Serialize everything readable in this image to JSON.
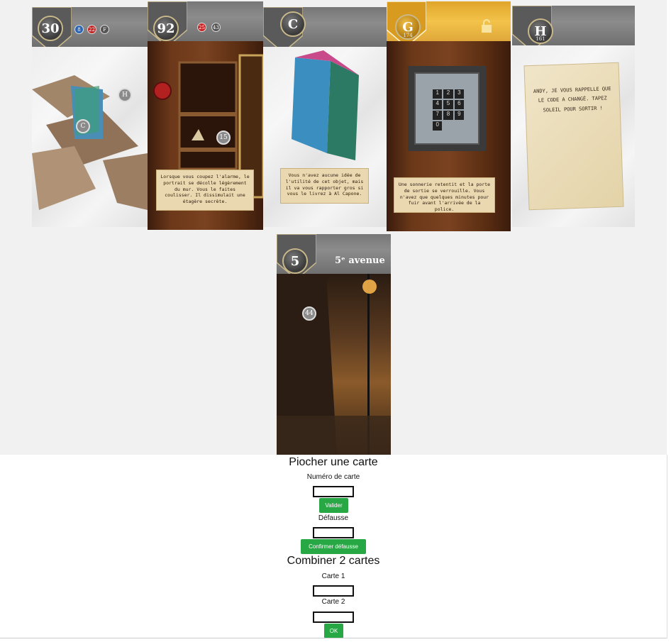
{
  "cards": [
    {
      "number": "30",
      "tokens": [
        {
          "label": "8",
          "color": "#2a66b5"
        },
        {
          "label": "22",
          "color": "#c42525"
        },
        {
          "label": "F",
          "color": "#555555"
        }
      ],
      "markers": [
        "H",
        "C"
      ]
    },
    {
      "number": "92",
      "tokens": [
        {
          "label": "25",
          "color": "#c42525"
        },
        {
          "label": "43",
          "color": "#555555"
        }
      ],
      "markers": [
        "15"
      ],
      "note": "Lorsque vous coupez l'alarme, le portrait se décolle légèrement du mur. Vous le faites coulisser. Il dissimulait une étagère secrète."
    },
    {
      "number": "C",
      "note": "Vous n'avez aucune idée de l'utilité de cet objet, mais il va vous rapporter gros si vous le livrez à Al Capone."
    },
    {
      "number": "G",
      "subnumber": "174",
      "keypad": [
        "1",
        "2",
        "3",
        "4",
        "5",
        "6",
        "7",
        "8",
        "9",
        "0"
      ],
      "note": "Une sonnerie retentit et la porte de sortie se verrouille. Vous n'avez que quelques minutes pour fuir avant l'arrivée de la police."
    },
    {
      "number": "H",
      "subnumber": "161",
      "letter": "ANDY, JE VOUS RAPPELLE QUE LE CODE A CHANGÉ. TAPEZ SOLEIL POUR SORTIR !"
    },
    {
      "number": "5",
      "title": "5ᵉ avenue",
      "markers": [
        "44"
      ]
    }
  ],
  "panel": {
    "draw_title": "Piocher une carte",
    "card_number_label": "Numéro de carte",
    "card_number_value": "",
    "validate_label": "Valider",
    "discard_label": "Défausse",
    "discard_value": "",
    "confirm_discard_label": "Confirmer défausse",
    "combine_title": "Combiner 2 cartes",
    "card1_label": "Carte 1",
    "card1_value": "",
    "card2_label": "Carte 2",
    "card2_value": "",
    "ok_label": "OK"
  },
  "colors": {
    "button_green": "#28a745",
    "card_header_gray": "#7a7a7a",
    "card_header_gold": "#f3c34a"
  }
}
